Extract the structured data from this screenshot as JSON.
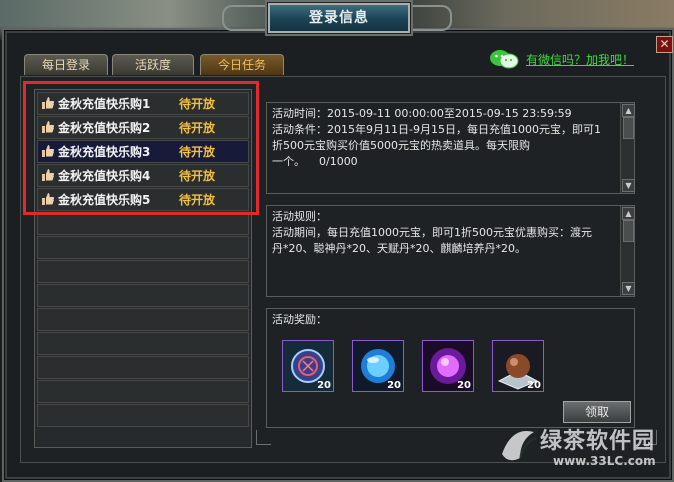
{
  "window": {
    "title": "登录信息",
    "close_label": "✕"
  },
  "tabs": [
    {
      "label": "每日登录",
      "active": false
    },
    {
      "label": "活跃度",
      "active": false
    },
    {
      "label": "今日任务",
      "active": true
    }
  ],
  "wechat": {
    "icon": "wechat-icon",
    "link_text": "有微信吗？加我吧！"
  },
  "activity_list": [
    {
      "name": "金秋充值快乐购1",
      "status": "待开放",
      "selected": false
    },
    {
      "name": "金秋充值快乐购2",
      "status": "待开放",
      "selected": false
    },
    {
      "name": "金秋充值快乐购3",
      "status": "待开放",
      "selected": true
    },
    {
      "name": "金秋充值快乐购4",
      "status": "待开放",
      "selected": false
    },
    {
      "name": "金秋充值快乐购5",
      "status": "待开放",
      "selected": false
    }
  ],
  "detail": {
    "time_line": "活动时间：2015-09-11 00:00:00至2015-09-15 23:59:59",
    "cond_1": "活动条件：2015年9月11日-9月15日，每日充值1000元宝，即可1",
    "cond_2": "折500元宝购买价值5000元宝的热卖道具。每天限购",
    "cond_3": "一个。    0/1000"
  },
  "rules": {
    "line_1": "活动规则：",
    "line_2": "活动期间，每日充值1000元宝，即可1折500元宝优惠购买：渡元",
    "line_3": "丹*20、聪神丹*20、天赋丹*20、麒麟培养丹*20。"
  },
  "rewards": {
    "label": "活动奖励：",
    "items": [
      {
        "icon": "rune-orb-icon",
        "count": "20"
      },
      {
        "icon": "blue-orb-icon",
        "count": "20"
      },
      {
        "icon": "purple-orb-icon",
        "count": "20"
      },
      {
        "icon": "bronze-orb-icon",
        "count": "20"
      }
    ],
    "claim_label": "领取"
  },
  "watermark": {
    "text": "绿茶软件园",
    "url": "www.33LC.com"
  },
  "colors": {
    "status": "#f2c040",
    "highlight": "#e32a2a",
    "link": "#3ddc3d"
  }
}
